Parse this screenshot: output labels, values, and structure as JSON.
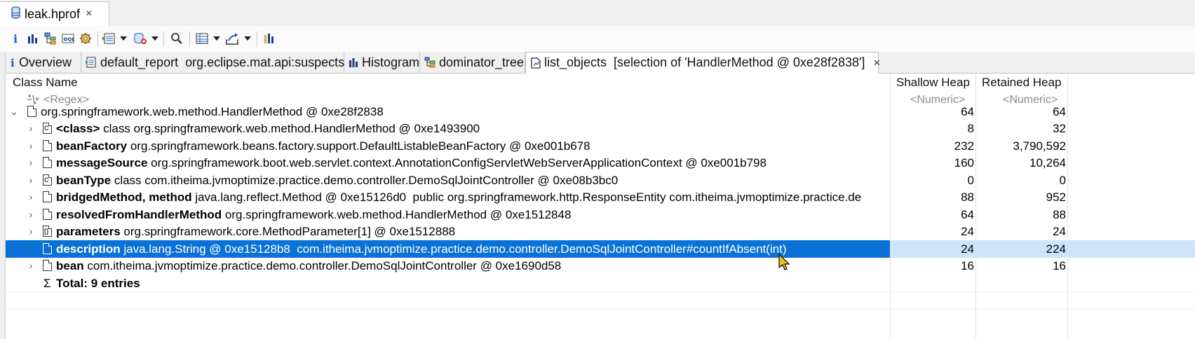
{
  "editor": {
    "tab_title": "leak.hprof",
    "close_glyph": "×"
  },
  "toolbar": {
    "icons": [
      "info-icon",
      "histogram-icon",
      "dominator-tree-icon",
      "oql-icon",
      "heap-dump-overview-icon",
      "reports-icon",
      "query-browser-icon",
      "find-object-icon",
      "group-by-icon",
      "export-icon",
      "pin-icon"
    ]
  },
  "view_tabs": [
    {
      "label": "Overview",
      "icon": "info-icon"
    },
    {
      "label": "default_report  org.eclipse.mat.api:suspects",
      "icon": "report-icon"
    },
    {
      "label": "Histogram",
      "icon": "histogram-icon"
    },
    {
      "label": "dominator_tree",
      "icon": "dominator-tree-icon"
    },
    {
      "label": "list_objects  [selection of 'HandlerMethod @ 0xe28f2838']",
      "icon": "list-objects-icon",
      "active": true
    }
  ],
  "table": {
    "columns": [
      "Class Name",
      "Shallow Heap",
      "Retained Heap"
    ],
    "filter": {
      "class_name": "<Regex>",
      "shallow": "<Numeric>",
      "retained": "<Numeric>"
    },
    "root": {
      "text": "org.springframework.web.method.HandlerMethod @ 0xe28f2838",
      "shallow": "64",
      "retained": "64"
    },
    "rows": [
      {
        "field": "<class>",
        "value": "class org.springframework.web.method.HandlerMethod @ 0xe1493900",
        "shallow": "8",
        "retained": "32",
        "icon": "class-file-icon"
      },
      {
        "field": "beanFactory",
        "value": "org.springframework.beans.factory.support.DefaultListableBeanFactory @ 0xe001b678",
        "shallow": "232",
        "retained": "3,790,592",
        "icon": "object-file-icon"
      },
      {
        "field": "messageSource",
        "value": "org.springframework.boot.web.servlet.context.AnnotationConfigServletWebServerApplicationContext @ 0xe001b798",
        "shallow": "160",
        "retained": "10,264",
        "icon": "object-file-icon"
      },
      {
        "field": "beanType",
        "value": "class com.itheima.jvmoptimize.practice.demo.controller.DemoSqlJointController @ 0xe08b3bc0",
        "shallow": "0",
        "retained": "0",
        "icon": "class-file-icon"
      },
      {
        "field": "bridgedMethod, method",
        "value": "java.lang.reflect.Method @ 0xe15126d0  public org.springframework.http.ResponseEntity com.itheima.jvmoptimize.practice.de",
        "shallow": "88",
        "retained": "952",
        "icon": "object-file-icon"
      },
      {
        "field": "resolvedFromHandlerMethod",
        "value": "org.springframework.web.method.HandlerMethod @ 0xe1512848",
        "shallow": "64",
        "retained": "88",
        "icon": "object-file-icon"
      },
      {
        "field": "parameters",
        "value": "org.springframework.core.MethodParameter[1] @ 0xe1512888",
        "shallow": "24",
        "retained": "24",
        "icon": "array-file-icon"
      },
      {
        "field": "description",
        "value": "java.lang.String @ 0xe15128b8  com.itheima.jvmoptimize.practice.demo.controller.DemoSqlJointController#countIfAbsent(int)",
        "shallow": "24",
        "retained": "224",
        "icon": "object-file-icon",
        "selected": true
      },
      {
        "field": "bean",
        "value": "com.itheima.jvmoptimize.practice.demo.controller.DemoSqlJointController @ 0xe1690d58",
        "shallow": "16",
        "retained": "16",
        "icon": "object-file-icon"
      }
    ],
    "total": {
      "symbol": "Σ",
      "label": "Total: 9 entries"
    }
  },
  "colors": {
    "selection": "#0a72d6",
    "selection_light": "#cde4fb",
    "accent_icon": "#1f5fbf"
  }
}
